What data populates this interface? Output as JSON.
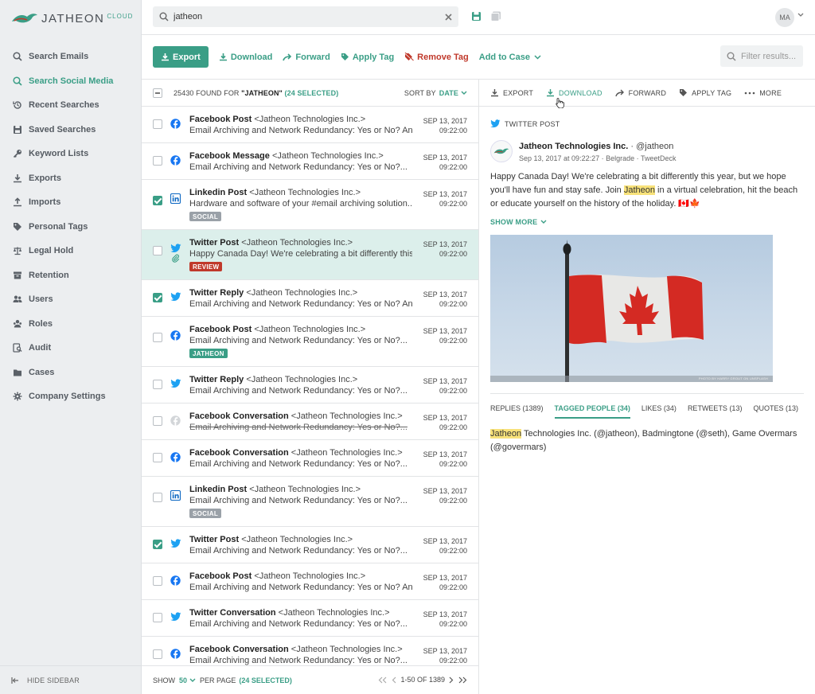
{
  "app": {
    "brand": "JATHEON",
    "brand_suffix": "CLOUD",
    "accent": "#3a9e86"
  },
  "sidebar": {
    "items": [
      {
        "label": "Search Emails",
        "icon": "search-icon",
        "active": false
      },
      {
        "label": "Search Social Media",
        "icon": "search-icon",
        "active": true
      },
      {
        "label": "Recent Searches",
        "icon": "history-icon",
        "active": false
      },
      {
        "label": "Saved Searches",
        "icon": "save-icon",
        "active": false
      },
      {
        "label": "Keyword Lists",
        "icon": "key-icon",
        "active": false
      },
      {
        "label": "Exports",
        "icon": "export-icon",
        "active": false
      },
      {
        "label": "Imports",
        "icon": "import-icon",
        "active": false
      },
      {
        "label": "Personal Tags",
        "icon": "tag-icon",
        "active": false
      },
      {
        "label": "Legal Hold",
        "icon": "scale-icon",
        "active": false
      },
      {
        "label": "Retention",
        "icon": "archive-icon",
        "active": false
      },
      {
        "label": "Users",
        "icon": "users-icon",
        "active": false
      },
      {
        "label": "Roles",
        "icon": "roles-icon",
        "active": false
      },
      {
        "label": "Audit",
        "icon": "audit-icon",
        "active": false
      },
      {
        "label": "Cases",
        "icon": "folder-icon",
        "active": false
      },
      {
        "label": "Company Settings",
        "icon": "gear-icon",
        "active": false
      }
    ],
    "hide_label": "HIDE SIDEBAR"
  },
  "topbar": {
    "search_value": "jatheon",
    "avatar_initials": "MA"
  },
  "toolbar": {
    "export": "Export",
    "download": "Download",
    "forward": "Forward",
    "apply_tag": "Apply Tag",
    "remove_tag": "Remove Tag",
    "add_to_case": "Add to Case",
    "filter_placeholder": "Filter results..."
  },
  "list": {
    "count": "25430",
    "found_for": "FOUND FOR",
    "query": "\"JATHEON\"",
    "selected": "(24 SELECTED)",
    "sort_label": "SORT BY",
    "sort_value": "DATE",
    "rows": [
      {
        "type": "Facebook Post",
        "from": "<Jatheon Technologies Inc.>",
        "preview": "Email Archiving and Network Redundancy: Yes or No? Any...",
        "date": "SEP 13, 2017",
        "time": "09:22:00",
        "checked": false,
        "network": "facebook",
        "tag": "",
        "tag_color": "",
        "selected": false,
        "struck": false,
        "attach": false
      },
      {
        "type": "Facebook Message",
        "from": "<Jatheon Technologies Inc.>",
        "preview": "Email Archiving and Network Redundancy: Yes or No?...",
        "date": "SEP 13, 2017",
        "time": "09:22:00",
        "checked": false,
        "network": "facebook",
        "tag": "",
        "tag_color": "",
        "selected": false,
        "struck": false,
        "attach": false
      },
      {
        "type": "Linkedin Post",
        "from": "<Jatheon Technologies Inc.>",
        "preview": "Hardware and software of your #email archiving solution...",
        "date": "SEP 13, 2017",
        "time": "09:22:00",
        "checked": true,
        "network": "linkedin",
        "tag": "SOCIAL",
        "tag_color": "#9aa1a8",
        "selected": false,
        "struck": false,
        "attach": false
      },
      {
        "type": "Twitter Post",
        "from": "<Jatheon Technologies Inc.>",
        "preview": "Happy Canada Day! We're celebrating a bit differently this...",
        "date": "SEP 13, 2017",
        "time": "09:22:00",
        "checked": false,
        "network": "twitter",
        "tag": "REVIEW",
        "tag_color": "#c0392b",
        "selected": true,
        "struck": false,
        "attach": true
      },
      {
        "type": "Twitter Reply",
        "from": "<Jatheon Technologies Inc.>",
        "preview": "Email Archiving and Network Redundancy: Yes or No? Any...",
        "date": "SEP 13, 2017",
        "time": "09:22:00",
        "checked": true,
        "network": "twitter",
        "tag": "",
        "tag_color": "",
        "selected": false,
        "struck": false,
        "attach": false
      },
      {
        "type": "Facebook Post",
        "from": "<Jatheon Technologies Inc.>",
        "preview": "Email Archiving and Network Redundancy: Yes or No?...",
        "date": "SEP 13, 2017",
        "time": "09:22:00",
        "checked": false,
        "network": "facebook",
        "tag": "JATHEON",
        "tag_color": "#3a9e86",
        "selected": false,
        "struck": false,
        "attach": false
      },
      {
        "type": "Twitter Reply",
        "from": "<Jatheon Technologies Inc.>",
        "preview": "Email Archiving and Network Redundancy: Yes or No?...",
        "date": "SEP 13, 2017",
        "time": "09:22:00",
        "checked": false,
        "network": "twitter",
        "tag": "",
        "tag_color": "",
        "selected": false,
        "struck": false,
        "attach": false
      },
      {
        "type": "Facebook Conversation",
        "from": "<Jatheon Technologies Inc.>",
        "preview": "Email Archiving and Network Redundancy: Yes or No?...",
        "date": "SEP 13, 2017",
        "time": "09:22:00",
        "checked": false,
        "network": "facebook-muted",
        "tag": "",
        "tag_color": "",
        "selected": false,
        "struck": true,
        "attach": false
      },
      {
        "type": "Facebook Conversation",
        "from": "<Jatheon Technologies Inc.>",
        "preview": "Email Archiving and Network Redundancy: Yes or No?...",
        "date": "SEP 13, 2017",
        "time": "09:22:00",
        "checked": false,
        "network": "facebook",
        "tag": "",
        "tag_color": "",
        "selected": false,
        "struck": false,
        "attach": false
      },
      {
        "type": "Linkedin Post",
        "from": "<Jatheon Technologies Inc.>",
        "preview": "Email Archiving and Network Redundancy: Yes or No?...",
        "date": "SEP 13, 2017",
        "time": "09:22:00",
        "checked": false,
        "network": "linkedin",
        "tag": "SOCIAL",
        "tag_color": "#9aa1a8",
        "selected": false,
        "struck": false,
        "attach": false
      },
      {
        "type": "Twitter Post",
        "from": "<Jatheon Technologies Inc.>",
        "preview": "Email Archiving and Network Redundancy: Yes or No?...",
        "date": "SEP 13, 2017",
        "time": "09:22:00",
        "checked": true,
        "network": "twitter",
        "tag": "",
        "tag_color": "",
        "selected": false,
        "struck": false,
        "attach": false
      },
      {
        "type": "Facebook Post",
        "from": "<Jatheon Technologies Inc.>",
        "preview": "Email Archiving and Network Redundancy: Yes or No? Any...",
        "date": "SEP 13, 2017",
        "time": "09:22:00",
        "checked": false,
        "network": "facebook",
        "tag": "",
        "tag_color": "",
        "selected": false,
        "struck": false,
        "attach": false
      },
      {
        "type": "Twitter Conversation",
        "from": "<Jatheon Technologies Inc.>",
        "preview": "Email Archiving and Network Redundancy: Yes or No?...",
        "date": "SEP 13, 2017",
        "time": "09:22:00",
        "checked": false,
        "network": "twitter",
        "tag": "",
        "tag_color": "",
        "selected": false,
        "struck": false,
        "attach": false
      },
      {
        "type": "Facebook Conversation",
        "from": "<Jatheon Technologies Inc.>",
        "preview": "Email Archiving and Network Redundancy: Yes or No?...",
        "date": "SEP 13, 2017",
        "time": "09:22:00",
        "checked": false,
        "network": "facebook",
        "tag": "",
        "tag_color": "",
        "selected": false,
        "struck": false,
        "attach": false
      }
    ]
  },
  "footer": {
    "show": "SHOW",
    "per_page_value": "50",
    "per_page": "PER PAGE",
    "selected": "(24 SELECTED)",
    "range": "1-50 OF 1389"
  },
  "detail": {
    "toolbar": {
      "export": "EXPORT",
      "download": "DOWNLOAD",
      "forward": "FORWARD",
      "apply_tag": "APPLY TAG",
      "more": "MORE"
    },
    "post_type": "TWITTER POST",
    "author_name": "Jatheon Technologies Inc.",
    "author_handle": "· @jatheon",
    "meta": "Sep 13, 2017 at 09:22:27 · Belgrade · TweetDeck",
    "text_before": "Happy Canada Day! We're celebrating a bit differently this year, but we hope you'll have fun and stay safe. Join ",
    "text_highlight": "Jatheon",
    "text_after": " in a virtual celebration, hit the beach or educate yourself on the history of the holiday. 🇨🇦🍁",
    "show_more": "SHOW MORE",
    "photo_credit": "PHOTO BY HARRY GROUT ON UNSPLASH",
    "tabs": [
      {
        "label": "REPLIES (1389)",
        "active": false
      },
      {
        "label": "TAGGED PEOPLE (34)",
        "active": true
      },
      {
        "label": "LIKES (34)",
        "active": false
      },
      {
        "label": "RETWEETS (13)",
        "active": false
      },
      {
        "label": "QUOTES (13)",
        "active": false
      }
    ],
    "people_highlight": "Jatheon",
    "people_rest": " Technologies Inc. (@jatheon), Badmingtone (@seth), Game Overmars (@govermars)"
  }
}
